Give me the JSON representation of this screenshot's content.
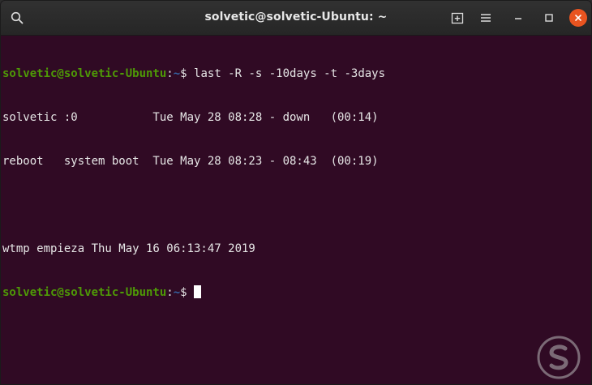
{
  "window": {
    "title": "solvetic@solvetic-Ubuntu: ~"
  },
  "titlebar": {
    "search_icon": "search-icon",
    "new_tab_icon": "new-tab-icon",
    "menu_icon": "hamburger-menu-icon",
    "minimize_icon": "minimize-icon",
    "maximize_icon": "maximize-icon",
    "close_icon": "close-icon"
  },
  "terminal": {
    "prompt_user": "solvetic@solvetic-Ubuntu",
    "prompt_colon": ":",
    "prompt_dir": "~",
    "prompt_symbol": "$ ",
    "command": "last -R -s -10days -t -3days",
    "output": [
      "solvetic :0           Tue May 28 08:28 - down   (00:14)",
      "reboot   system boot  Tue May 28 08:23 - 08:43  (00:19)",
      "",
      "wtmp empieza Thu May 16 06:13:47 2019"
    ]
  },
  "colors": {
    "terminal_bg": "#300a24",
    "prompt_user": "#4e9a06",
    "prompt_dir": "#3465a4",
    "close_button": "#e95420",
    "titlebar": "#2b2b2b"
  },
  "watermark": {
    "icon": "solvetic-logo"
  }
}
